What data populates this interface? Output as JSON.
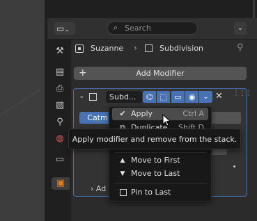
{
  "header": {
    "search_placeholder": "Search",
    "editor_type_icon": "properties-editor-icon"
  },
  "tabs": [
    {
      "name": "tool",
      "icon": "tool-icon"
    },
    {
      "name": "render",
      "icon": "render-icon"
    },
    {
      "name": "output",
      "icon": "output-icon"
    },
    {
      "name": "view-layer",
      "icon": "view-layer-icon"
    },
    {
      "name": "scene",
      "icon": "scene-icon"
    },
    {
      "name": "world",
      "icon": "world-icon"
    },
    {
      "name": "collection",
      "icon": "collection-icon"
    },
    {
      "name": "object",
      "icon": "object-icon"
    }
  ],
  "breadcrumb": {
    "object": "Suzanne",
    "modifier": "Subdivision"
  },
  "add_modifier_label": "Add Modifier",
  "modifier": {
    "name": "Subd...",
    "catmull_label": "Catm",
    "advanced_label": "Ad"
  },
  "menu": {
    "items": [
      {
        "label": "Apply",
        "shortcut": "Ctrl A",
        "icon": "check-icon",
        "highlighted": true
      },
      {
        "label": "Duplicate",
        "shortcut": "Shift D",
        "icon": "duplicate-icon"
      },
      {
        "label": "Move to First",
        "icon": "triangle-up-icon"
      },
      {
        "label": "Move to Last",
        "icon": "triangle-down-icon"
      },
      {
        "label": "Pin to Last",
        "icon": "checkbox-icon"
      }
    ]
  },
  "tooltip": "Apply modifier and remove from the stack.",
  "colors": {
    "accent": "#4772b3",
    "panel": "#2b2b2b",
    "menu_bg": "#181818",
    "object_tab": "#e87d0d"
  }
}
